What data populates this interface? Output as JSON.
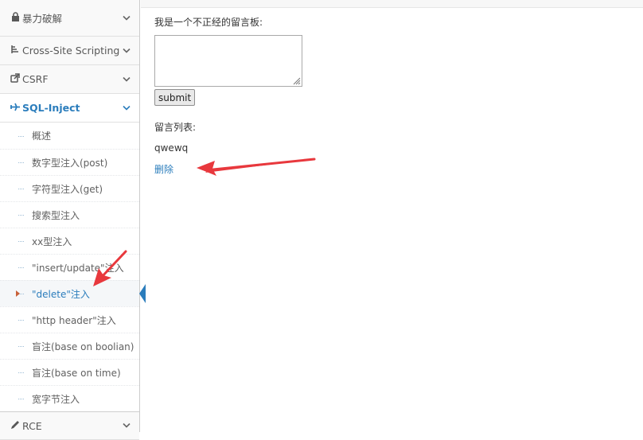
{
  "sidebar": {
    "items": [
      {
        "label": "暴力破解",
        "icon": "lock-icon"
      },
      {
        "label": "Cross-Site Scripting",
        "icon": "list-tree-icon"
      },
      {
        "label": "CSRF",
        "icon": "external-link-icon"
      },
      {
        "label": "SQL-Inject",
        "icon": "plane-icon",
        "active": true
      },
      {
        "label": "RCE",
        "icon": "pencil-icon"
      }
    ],
    "sql_submenu": [
      "概述",
      "数字型注入(post)",
      "字符型注入(get)",
      "搜索型注入",
      "xx型注入",
      "\"insert/update\"注入",
      "\"delete\"注入",
      "\"http header\"注入",
      "盲注(base on boolian)",
      "盲注(base on time)",
      "宽字节注入"
    ],
    "active_sub_index": 6
  },
  "main": {
    "board_label": "我是一个不正经的留言板:",
    "textarea_value": "",
    "submit_label": "submit",
    "list_label": "留言列表:",
    "messages": [
      {
        "text": "qwewq",
        "delete_label": "删除"
      }
    ]
  },
  "colors": {
    "accent": "#2b7dbc",
    "annotation_arrow": "#e8383d"
  }
}
